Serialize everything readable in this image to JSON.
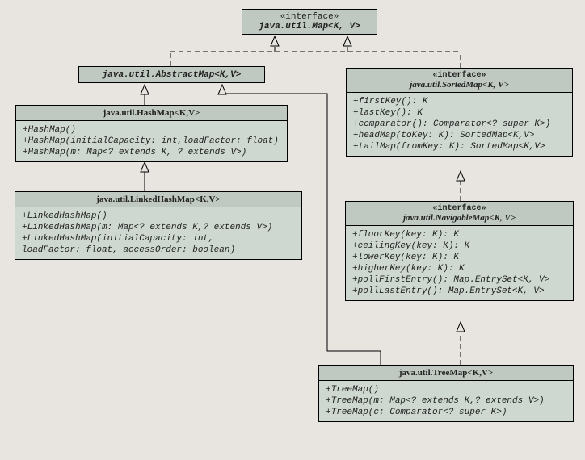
{
  "diagram": {
    "type": "uml-class",
    "map": {
      "stereo": "«interface»",
      "title": "java.util.Map<K, V>"
    },
    "abstractMap": {
      "title": "java.util.AbstractMap<K,V>"
    },
    "hashMap": {
      "title": "java.util.HashMap<K,V>",
      "m1": "+HashMap()",
      "m2": "+HashMap(initialCapacity: int,loadFactor: float)",
      "m3": "+HashMap(m: Map<? extends K, ? extends V>)"
    },
    "linkedHashMap": {
      "title": "java.util.LinkedHashMap<K,V>",
      "m1": "+LinkedHashMap()",
      "m2": "+LinkedHashMap(m: Map<? extends K,? extends V>)",
      "m3": "+LinkedHashMap(initialCapacity: int,",
      "m4": "  loadFactor: float, accessOrder: boolean)"
    },
    "sortedMap": {
      "stereo": "«interface»",
      "title": "java.util.SortedMap<K, V>",
      "m1": "+firstKey(): K",
      "m2": "+lastKey(): K",
      "m3": "+comparator(): Comparator<? super K>)",
      "m4": "+headMap(toKey: K): SortedMap<K,V>",
      "m5": "+tailMap(fromKey: K): SortedMap<K,V>"
    },
    "navigableMap": {
      "stereo": "«interface»",
      "title": "java.util.NavigableMap<K, V>",
      "m1": "+floorKey(key: K): K",
      "m2": "+ceilingKey(key: K): K",
      "m3": "+lowerKey(key: K): K",
      "m4": "+higherKey(key: K): K",
      "m5": "+pollFirstEntry(): Map.EntrySet<K, V>",
      "m6": "+pollLastEntry(): Map.EntrySet<K, V>"
    },
    "treeMap": {
      "title": "java.util.TreeMap<K,V>",
      "m1": "+TreeMap()",
      "m2": "+TreeMap(m: Map<? extends K,? extends V>)",
      "m3": "+TreeMap(c: Comparator<? super K>)"
    }
  }
}
